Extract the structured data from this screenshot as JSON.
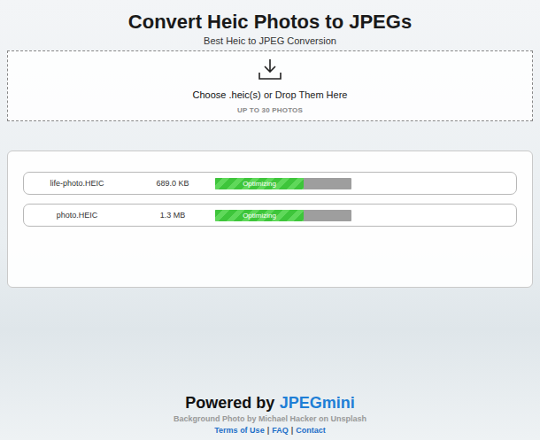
{
  "header": {
    "title": "Convert Heic Photos to JPEGs",
    "subtitle": "Best Heic to JPEG Conversion"
  },
  "dropzone": {
    "prompt_link": "Choose .heic(s)",
    "prompt_rest": "or Drop Them Here",
    "limit": "UP TO 30 PHOTOS"
  },
  "files": [
    {
      "name": "life-photo.HEIC",
      "size": "689.0 KB",
      "status": "Optimizing",
      "level": 0.65
    },
    {
      "name": "photo.HEIC",
      "size": "1.3 MB",
      "status": "Optimizing",
      "level": 0.65
    }
  ],
  "footer": {
    "powered": "Powered by",
    "brand": "JPEGmini",
    "credit": "Background Photo by Michael Hacker on Unsplash",
    "links": [
      "Terms of Use",
      "FAQ",
      "Contact"
    ],
    "separator": "|"
  }
}
